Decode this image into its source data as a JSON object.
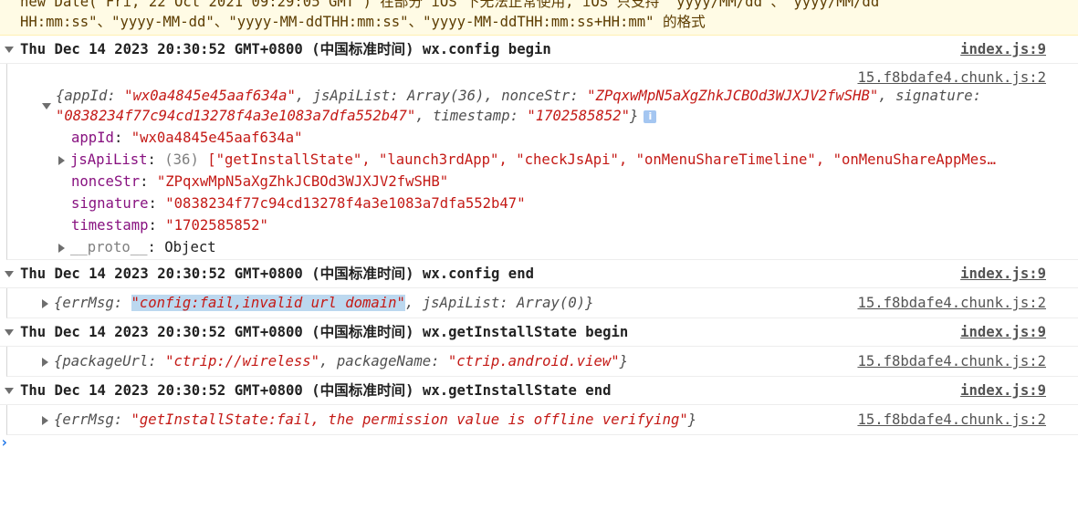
{
  "warning": {
    "line1": "new Date(\"Fri, 22 Oct 2021 09:29:05 GMT\") 在部分 iOS 下无法正常使用, iOS 只支持 \"yyyy/MM/dd\"、\"yyyy/MM/dd",
    "line2": "HH:mm:ss\"、\"yyyy-MM-dd\"、\"yyyy-MM-ddTHH:mm:ss\"、\"yyyy-MM-ddTHH:mm:ss+HH:mm\" 的格式"
  },
  "groups": [
    {
      "header": "Thu Dec 14 2023 20:30:52 GMT+0800 (中国标准时间) wx.config begin",
      "source": "index.js:9",
      "body_source": "15.f8bdafe4.chunk.js:2",
      "summary": {
        "line1_open": "{appId: ",
        "appId": "\"wx0a4845e45aaf634a\"",
        "jsApiList_key": ", jsApiList: ",
        "jsApiList_val": "Array(36)",
        "nonceStr_key": ", nonceStr: ",
        "nonceStr": "\"ZPqxwMpN5aXgZhkJCBOd3WJXJV2fwSHB\"",
        "signature_key": ", signature:",
        "signature": "\"0838234f77c94cd13278f4a3e1083a7dfa552b47\"",
        "timestamp_key": ", timestamp: ",
        "timestamp": "\"1702585852\"",
        "close": "}",
        "info": "i"
      },
      "props": {
        "appId_key": "appId",
        "appId_val": "\"wx0a4845e45aaf634a\"",
        "jsApiList_key": "jsApiList",
        "jsApiList_count": "(36)",
        "jsApiList_items": "[\"getInstallState\", \"launch3rdApp\", \"checkJsApi\", \"onMenuShareTimeline\", \"onMenuShareAppMes…",
        "nonceStr_key": "nonceStr",
        "nonceStr_val": "\"ZPqxwMpN5aXgZhkJCBOd3WJXJV2fwSHB\"",
        "signature_key": "signature",
        "signature_val": "\"0838234f77c94cd13278f4a3e1083a7dfa552b47\"",
        "timestamp_key": "timestamp",
        "timestamp_val": "\"1702585852\"",
        "proto_key": "__proto__",
        "proto_val": "Object"
      }
    },
    {
      "header": "Thu Dec 14 2023 20:30:52 GMT+0800 (中国标准时间) wx.config end",
      "source": "index.js:9",
      "body_source": "15.f8bdafe4.chunk.js:2",
      "errMsg_key": "{errMsg: ",
      "errMsg_val": "\"config:fail,invalid url domain\"",
      "rest": ", jsApiList: Array(0)}"
    },
    {
      "header": "Thu Dec 14 2023 20:30:52 GMT+0800 (中国标准时间) wx.getInstallState begin",
      "source": "index.js:9",
      "body_source": "15.f8bdafe4.chunk.js:2",
      "k1": "{packageUrl: ",
      "v1": "\"ctrip://wireless\"",
      "k2": ", packageName: ",
      "v2": "\"ctrip.android.view\"",
      "close": "}"
    },
    {
      "header": "Thu Dec 14 2023 20:30:52 GMT+0800 (中国标准时间) wx.getInstallState end",
      "source": "index.js:9",
      "body_source": "15.f8bdafe4.chunk.js:2",
      "k1": "{errMsg: ",
      "v1": "\"getInstallState:fail, the permission value is offline verifying\"",
      "close": "}"
    }
  ],
  "prompt_symbol": "›",
  "colors": {
    "string": "#c41a16",
    "property": "#881280",
    "warning_bg": "#fffbe5",
    "selection": "#bcd8ef",
    "prompt": "#1a73e8"
  }
}
